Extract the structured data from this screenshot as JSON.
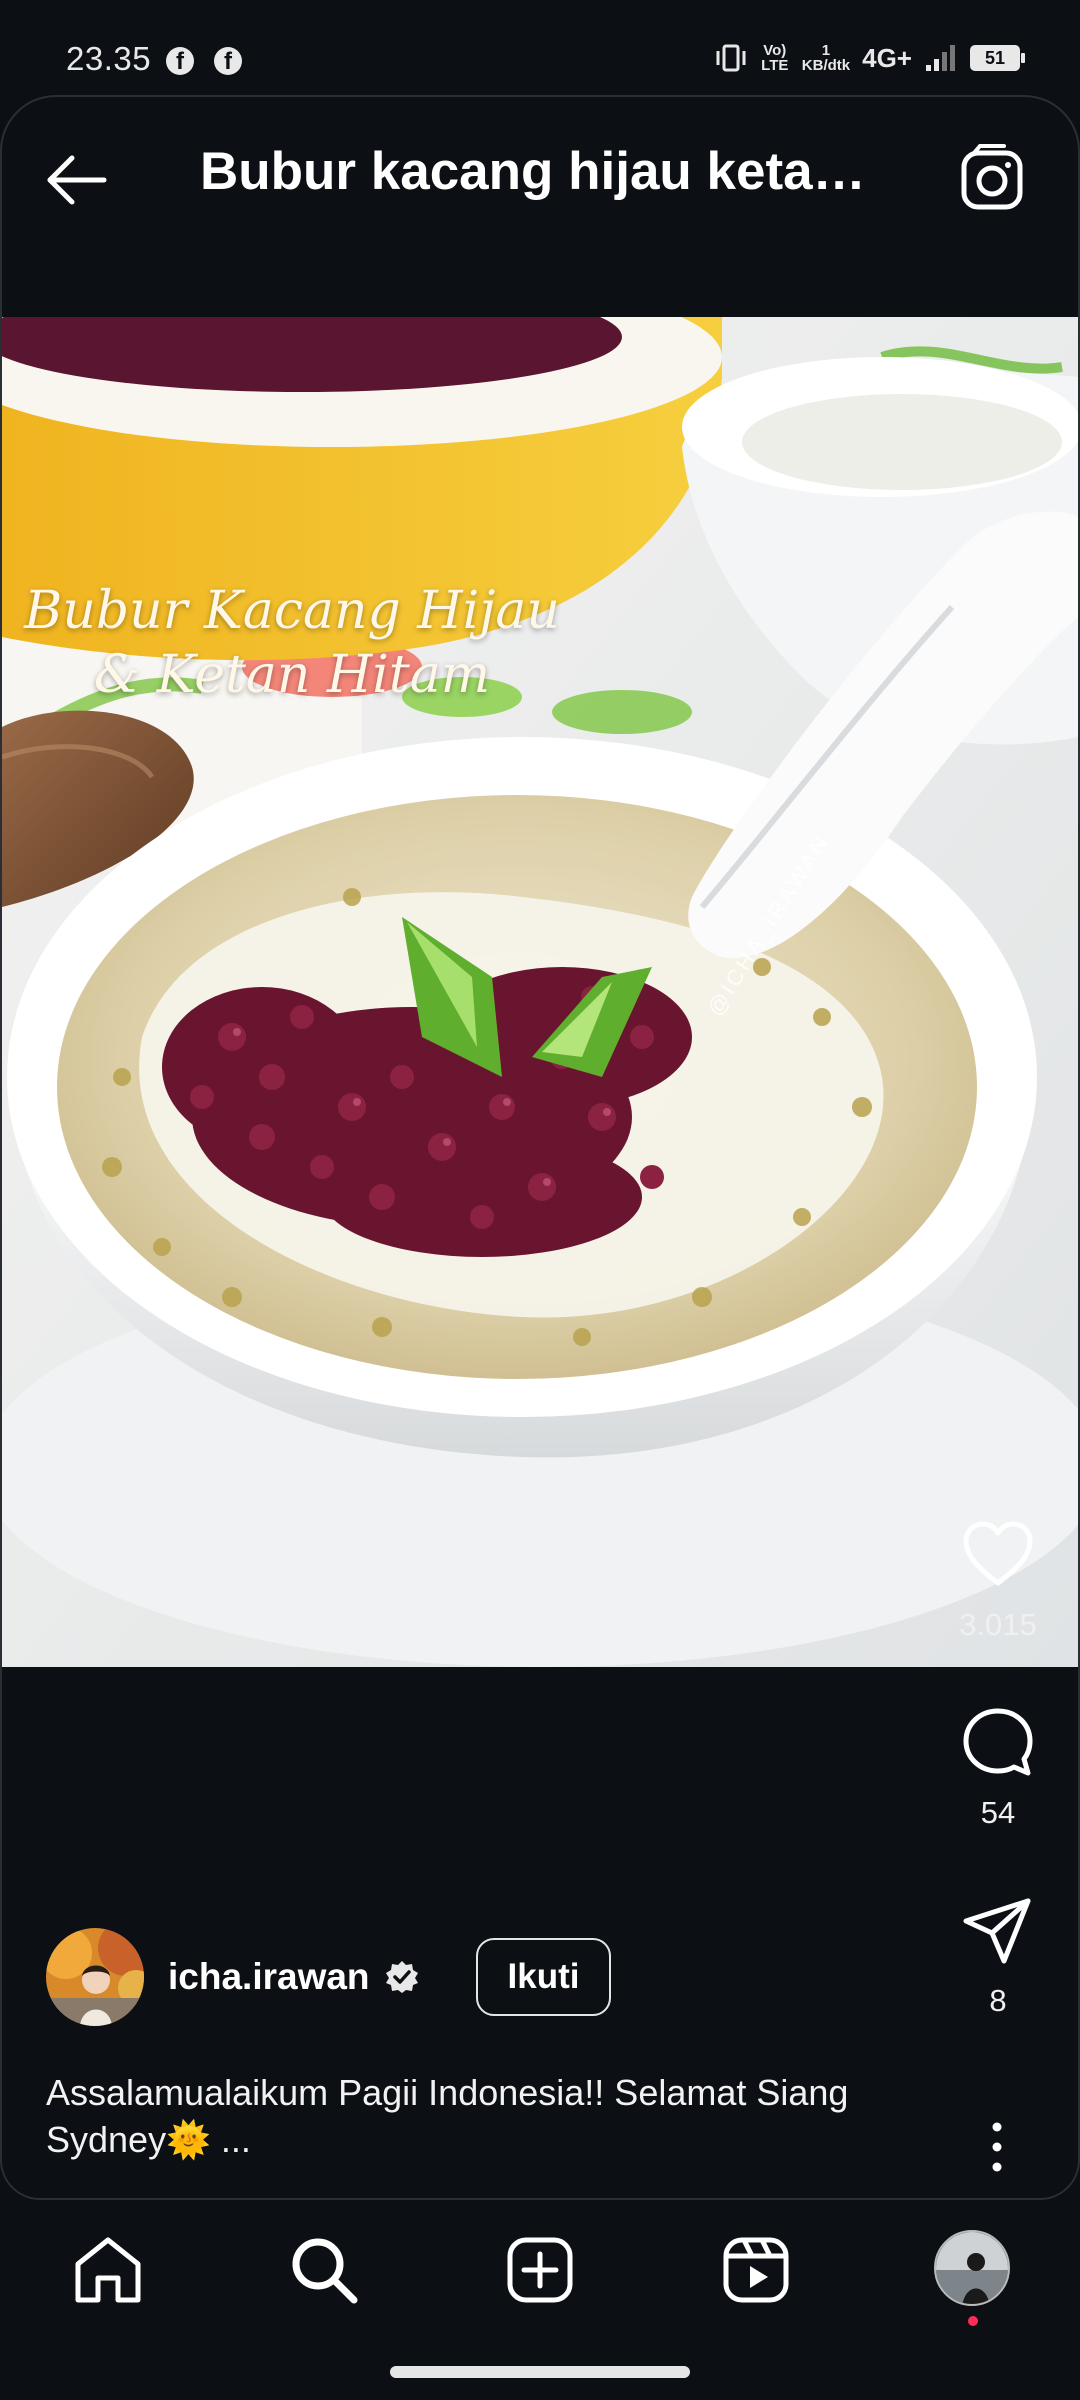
{
  "status_bar": {
    "time": "23.35",
    "volte": "Vo) LTE",
    "speed_value": "1",
    "speed_unit": "KB/dtk",
    "network": "4G+",
    "battery": "51"
  },
  "header": {
    "title": "Bubur kacang hijau ketan hitam"
  },
  "post": {
    "image_caption_line1": "Bubur Kacang Hijau",
    "image_caption_line2": "& Ketan Hitam",
    "watermark": "@ICHA_IRAWAN",
    "likes": "3.015",
    "comments": "54",
    "shares": "8",
    "username": "icha.irawan",
    "follow_label": "Ikuti",
    "caption": "Assalamualaikum Pagii Indonesia!! Selamat Siang Sydney🌞",
    "caption_more": " ..."
  },
  "colors": {
    "background": "#0c1015",
    "text": "#ffffff",
    "notification_dot": "#ff2d55"
  }
}
